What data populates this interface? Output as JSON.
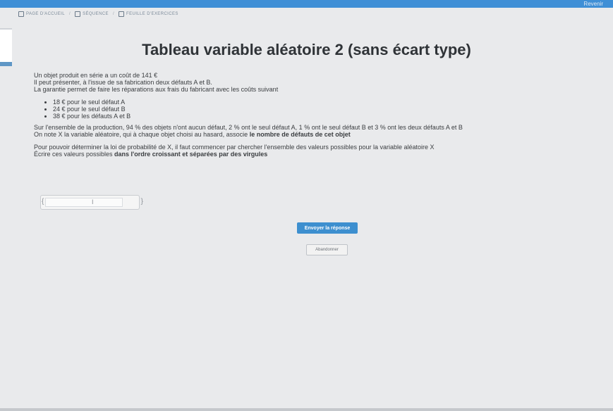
{
  "window": {
    "title": "Revenir"
  },
  "breadcrumb": {
    "items": [
      {
        "label": "PAGE D'ACCUEIL"
      },
      {
        "label": "SÉQUENCE"
      },
      {
        "label": "FEUILLE D'EXERCICES"
      }
    ],
    "separator": "/"
  },
  "page": {
    "title": "Tableau variable aléatoire 2 (sans écart type)"
  },
  "intro": {
    "line1": "Un objet produit en série a un coût de 141 €",
    "line2": "Il peut présenter, à l'issue de sa fabrication deux défauts A et B.",
    "line3": "La garantie permet de faire les réparations aux frais du fabricant avec les coûts suivant"
  },
  "costs": [
    "18 € pour le seul défaut A",
    "24 € pour le seul défaut B",
    "38 € pour les défauts A et B"
  ],
  "stats": {
    "line1": "Sur l'ensemble de la production, 94 % des objets n'ont aucun défaut, 2 % ont le seul défaut A, 1 % ont le seul défaut B et 3 % ont les deux défauts A et B",
    "line2_start": "On note X la variable aléatoire, qui à chaque objet choisi au hasard, associe ",
    "line2_bold": "le nombre de défauts de cet objet"
  },
  "question": {
    "line1": "Pour pouvoir déterminer la loi de probabilité de X, il faut commencer par chercher l'ensemble des valeurs possibles pour la variable aléatoire X",
    "line2_start": "Écrire ces valeurs possibles ",
    "line2_bold": "dans l'ordre croissant et séparées par des virgules"
  },
  "answer": {
    "open_brace": "{",
    "close_brace": "}",
    "caret": "I",
    "value": ""
  },
  "buttons": {
    "submit": "Envoyer la réponse",
    "abandon": "Abandonner"
  }
}
